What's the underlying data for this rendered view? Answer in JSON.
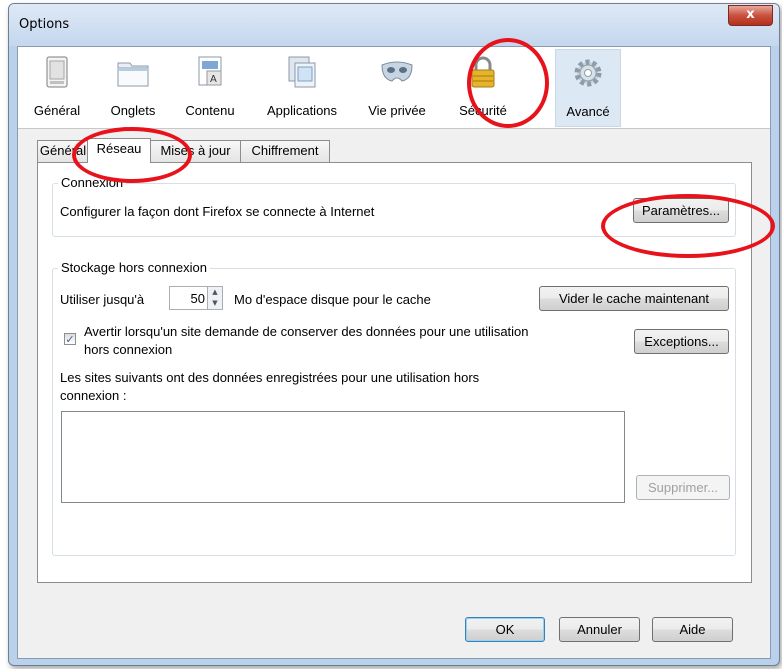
{
  "window": {
    "title": "Options",
    "close_label": "x"
  },
  "toolbar": {
    "items": [
      {
        "label": "Général",
        "icon": "general-window-icon"
      },
      {
        "label": "Onglets",
        "icon": "tabs-icon"
      },
      {
        "label": "Contenu",
        "icon": "content-icon"
      },
      {
        "label": "Applications",
        "icon": "applications-icon"
      },
      {
        "label": "Vie privée",
        "icon": "privacy-mask-icon"
      },
      {
        "label": "Sécurité",
        "icon": "padlock-icon"
      },
      {
        "label": "Avancé",
        "icon": "gear-icon",
        "selected": true
      }
    ]
  },
  "subtabs": [
    {
      "label": "Général"
    },
    {
      "label": "Réseau",
      "active": true
    },
    {
      "label": "Mises à jour"
    },
    {
      "label": "Chiffrement"
    }
  ],
  "connexion": {
    "legend": "Connexion",
    "description": "Configurer la façon dont Firefox se connecte à Internet",
    "settings_button": "Paramètres..."
  },
  "offline": {
    "legend": "Stockage hors connexion",
    "use_label": "Utiliser jusqu'à",
    "cache_value": "50",
    "cache_unit": "Mo d'espace disque pour le cache",
    "clear_button": "Vider le cache maintenant",
    "warn_line1": "Avertir lorsqu'un site demande de conserver des données pour une utilisation",
    "warn_line2": "hors connexion",
    "warn_checked": true,
    "exceptions_button": "Exceptions...",
    "sites_line1": "Les sites suivants ont des données enregistrées pour une utilisation hors",
    "sites_line2": "connexion :",
    "remove_button": "Supprimer..."
  },
  "footer": {
    "ok": "OK",
    "cancel": "Annuler",
    "help": "Aide"
  },
  "colors": {
    "annotation_ring": "#e8121b",
    "selected_tab": "#dde8f5",
    "title_bar": "#c4d7ee"
  }
}
